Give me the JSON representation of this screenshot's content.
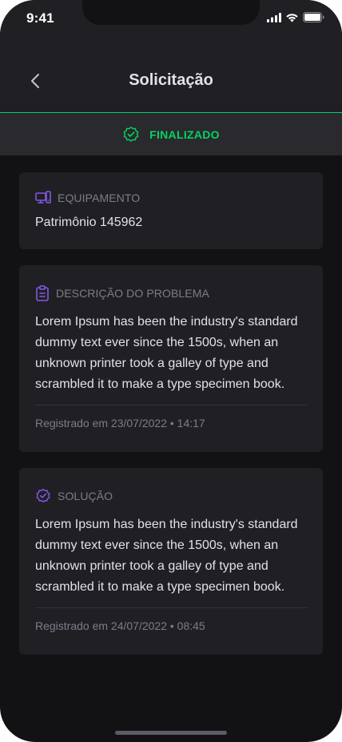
{
  "status_bar": {
    "time": "9:41"
  },
  "header": {
    "title": "Solicitação"
  },
  "status": {
    "label": "FINALIZADO",
    "color": "#04d361"
  },
  "cards": {
    "equipment": {
      "label": "EQUIPAMENTO",
      "value": "Patrimônio 145962",
      "icon": "devices-icon"
    },
    "problem": {
      "label": "DESCRIÇÃO DO PROBLEMA",
      "text": "Lorem Ipsum has been the industry's standard dummy text ever since the 1500s, when an unknown printer took a galley of type and scrambled it to make a type specimen book.",
      "footer": "Registrado em 23/07/2022 • 14:17",
      "icon": "clipboard-icon"
    },
    "solution": {
      "label": "SOLUÇÃO",
      "text": "Lorem Ipsum has been the industry's standard dummy text ever since the 1500s, when an unknown printer took a galley of type and scrambled it to make a type specimen book.",
      "footer": "Registrado em 24/07/2022 • 08:45",
      "icon": "check-badge-icon"
    }
  },
  "colors": {
    "accent_purple": "#8257e5",
    "success_green": "#04d361",
    "background": "#121214",
    "card": "#202024"
  }
}
